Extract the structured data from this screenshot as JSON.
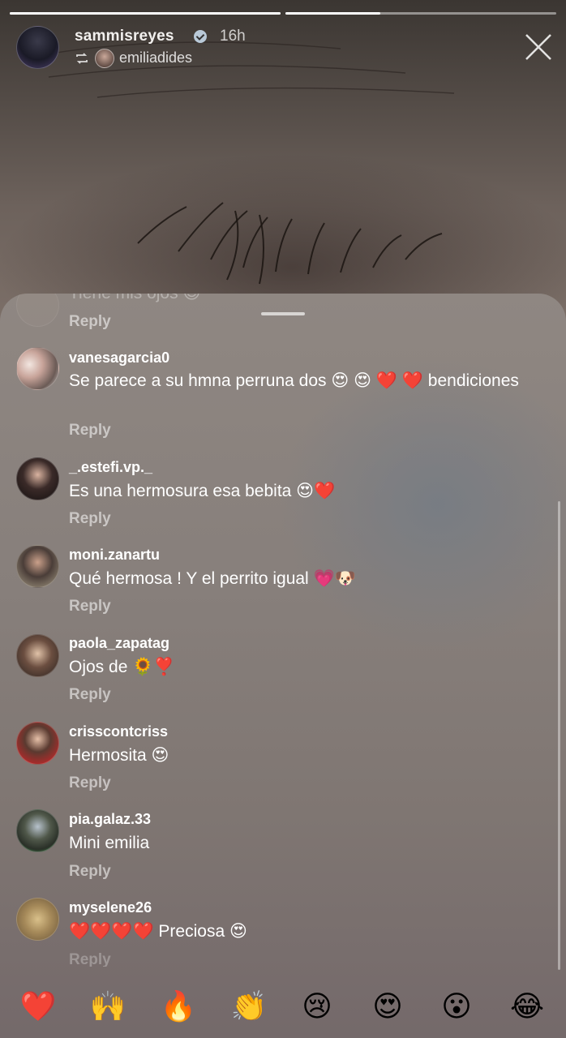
{
  "story": {
    "username": "sammisreyes",
    "time": "16h",
    "reposted_from": "emiliadides",
    "progress_segments": [
      1.0,
      0.35
    ]
  },
  "comments": [
    {
      "username": "",
      "text": "Tiene mis ojos 😊",
      "reply": "Reply",
      "faded": true
    },
    {
      "username": "vanesagarcia0",
      "text": "Se parece a su hmna perruna dos 😍 😍 ❤️ ❤️ bendiciones",
      "reply": "Reply"
    },
    {
      "username": "_.estefi.vp._",
      "text": "Es una hermosura esa bebita 😍❤️",
      "reply": "Reply"
    },
    {
      "username": "moni.zanartu",
      "text": "Qué hermosa ! Y el perrito igual 💗🐶",
      "reply": "Reply"
    },
    {
      "username": "paola_zapatag",
      "text": "Ojos de 🌻❣️",
      "reply": "Reply"
    },
    {
      "username": "crisscontcriss",
      "text": "Hermosita 😍",
      "reply": "Reply"
    },
    {
      "username": "pia.galaz.33",
      "text": "Mini emilia",
      "reply": "Reply"
    },
    {
      "username": "myselene26",
      "text": "❤️❤️❤️❤️ Preciosa 😍",
      "reply": "Reply"
    }
  ],
  "reactions": [
    {
      "emoji": "❤️",
      "icon": "red-heart-icon"
    },
    {
      "emoji": "🙌",
      "icon": "raising-hands-icon"
    },
    {
      "emoji": "🔥",
      "icon": "fire-icon"
    },
    {
      "emoji": "👏",
      "icon": "clapping-hands-icon"
    },
    {
      "emoji": "😢",
      "icon": "crying-face-icon"
    },
    {
      "emoji": "😍",
      "icon": "heart-eyes-icon"
    },
    {
      "emoji": "😮",
      "icon": "surprised-face-icon"
    },
    {
      "emoji": "😂",
      "icon": "tears-of-joy-icon"
    }
  ]
}
